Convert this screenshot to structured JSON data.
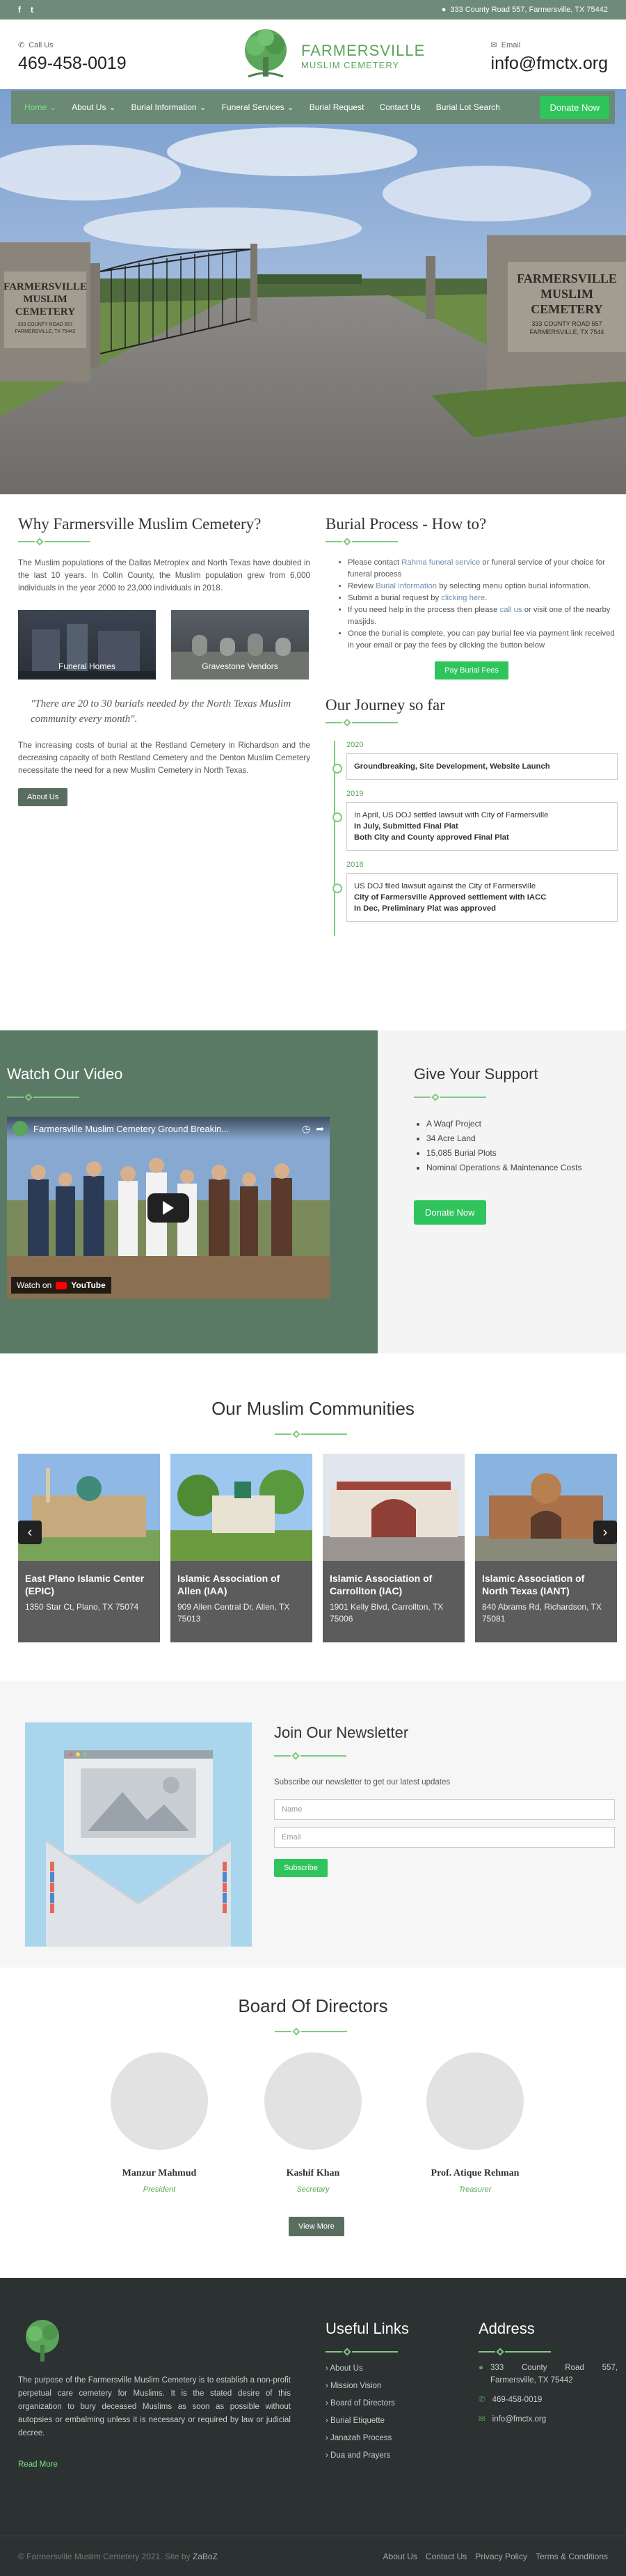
{
  "topbar": {
    "address": "333 County Road 557, Farmersville, TX 75442",
    "social": [
      "f",
      "t"
    ]
  },
  "header": {
    "call_label": "Call Us",
    "phone": "469-458-0019",
    "email_label": "Email",
    "email": "info@fmctx.org",
    "logo_line1": "FARMERSVILLE",
    "logo_line2": "MUSLIM CEMETERY"
  },
  "nav": {
    "items": [
      "Home",
      "About Us",
      "Burial Information",
      "Funeral Services",
      "Burial Request",
      "Contact Us",
      "Burial Lot Search"
    ],
    "donate": "Donate Now"
  },
  "hero": {
    "sign_left": [
      "FARMERSVILLE",
      "MUSLIM",
      "CEMETERY",
      "333 COUNTY ROAD 557",
      "FARMERSVILLE, TX 75442"
    ],
    "sign_right": [
      "FARMERSVILLE",
      "MUSLIM",
      "CEMETERY",
      "333 COUNTY ROAD 557",
      "FARMERSVILLE, TX 7544"
    ]
  },
  "why": {
    "title": "Why Farmersville Muslim Cemetery?",
    "p1": "The Muslim populations of the Dallas Metroplex and North Texas have doubled in the last 10 years. In Collin County, the Muslim population grew from 6,000 individuals in the year 2000 to 23,000 individuals in 2018.",
    "card1": "Funeral Homes",
    "card2": "Gravestone Vendors",
    "quote": "\"There are 20 to 30 burials needed by the North Texas Muslim community every month\".",
    "p2": "The increasing costs of burial at the Restland Cemetery in Richardson and the decreasing capacity of both Restland Cemetery and the Denton Muslim Cemetery necessitate the need for a new Muslim Cemetery in North Texas.",
    "button": "About Us"
  },
  "process": {
    "title": "Burial Process - How to?",
    "steps": [
      {
        "pre": "Please contact ",
        "link": "Rahma funeral service",
        "post": " or funeral service of your choice for funeral process"
      },
      {
        "pre": "Review ",
        "link": "Burial information",
        "post": " by selecting menu option burial information."
      },
      {
        "pre": "Submit a burial request by ",
        "link": "clicking here",
        "post": "."
      },
      {
        "pre": "If you need help in the process then please ",
        "link": "call us",
        "post": " or visit one of the nearby masjids."
      },
      {
        "pre": "Once the burial is complete, you can pay burial fee via payment link received in your email or pay the fees by clicking the button below",
        "link": "",
        "post": ""
      }
    ],
    "button": "Pay Burial Fees"
  },
  "journey": {
    "title": "Our Journey so far",
    "entries": [
      {
        "year": "2020",
        "lines": [
          {
            "t": "Groundbreaking, Site Development, Website Launch",
            "b": true
          }
        ]
      },
      {
        "year": "2019",
        "lines": [
          {
            "t": "In April, US DOJ settled lawsuit with City of Farmersville",
            "b": false
          },
          {
            "t": "In July, Submitted Final Plat",
            "b": true
          },
          {
            "t": "Both City and County approved Final Plat",
            "b": true
          }
        ]
      },
      {
        "year": "2018",
        "lines": [
          {
            "t": "US DOJ filed lawsuit against the City of Farmersville",
            "b": false
          },
          {
            "t": "City of Farmersville Approved settlement with IACC",
            "b": true
          },
          {
            "t": "In Dec, Preliminary Plat was approved",
            "b": true
          }
        ]
      }
    ]
  },
  "video": {
    "title": "Watch Our Video",
    "video_title": "Farmersville Muslim Cemetery Ground Breakin...",
    "watch_on": "Watch on",
    "youtube": "YouTube"
  },
  "support": {
    "title": "Give Your Support",
    "items": [
      "A Waqf Project",
      "34 Acre Land",
      "15,085 Burial Plots",
      "Nominal Operations & Maintenance Costs"
    ],
    "button": "Donate Now"
  },
  "communities": {
    "title": "Our Muslim Communities",
    "items": [
      {
        "name": "East Plano Islamic Center (EPIC)",
        "address": "1350 Star Ct, Plano, TX 75074"
      },
      {
        "name": "Islamic Association of Allen (IAA)",
        "address": "909 Allen Central Dr, Allen, TX 75013"
      },
      {
        "name": "Islamic Association of Carrollton (IAC)",
        "address": "1901 Kelly Blvd, Carrollton, TX 75006"
      },
      {
        "name": "Islamic Association of North Texas (IANT)",
        "address": "840 Abrams Rd, Richardson, TX 75081"
      }
    ]
  },
  "newsletter": {
    "title": "Join Our Newsletter",
    "text": "Subscribe our newsletter to get our latest updates",
    "name_placeholder": "Name",
    "email_placeholder": "Email",
    "button": "Subscribe"
  },
  "board": {
    "title": "Board Of Directors",
    "members": [
      {
        "name": "Manzur Mahmud",
        "role": "President"
      },
      {
        "name": "Kashif Khan",
        "role": "Secretary"
      },
      {
        "name": "Prof. Atique Rehman",
        "role": "Treasurer"
      }
    ],
    "button": "View More"
  },
  "footer": {
    "about": "The purpose of the Farmersville Muslim Cemetery is to establish a non-profit perpetual care cemetery for Muslims. It is the stated desire of this organization to bury deceased Muslims as soon as possible without autopsies or embalming unless it is necessary or required by law or judicial decree.",
    "read_more": "Read More",
    "links_title": "Useful Links",
    "links": [
      "About Us",
      "Mission Vision",
      "Board of Directors",
      "Burial Etiquette",
      "Janazah Process",
      "Dua and Prayers"
    ],
    "address_title": "Address",
    "address": "333 County Road 557, Farmersville, TX 75442",
    "phone": "469-458-0019",
    "email": "info@fmctx.org",
    "copyright": "© Farmersville Muslim Cemetery 2021. Site by ",
    "site_by": "ZaBoZ",
    "bottom_links": [
      "About Us",
      "Contact Us",
      "Privacy Policy",
      "Terms & Conditions"
    ]
  }
}
